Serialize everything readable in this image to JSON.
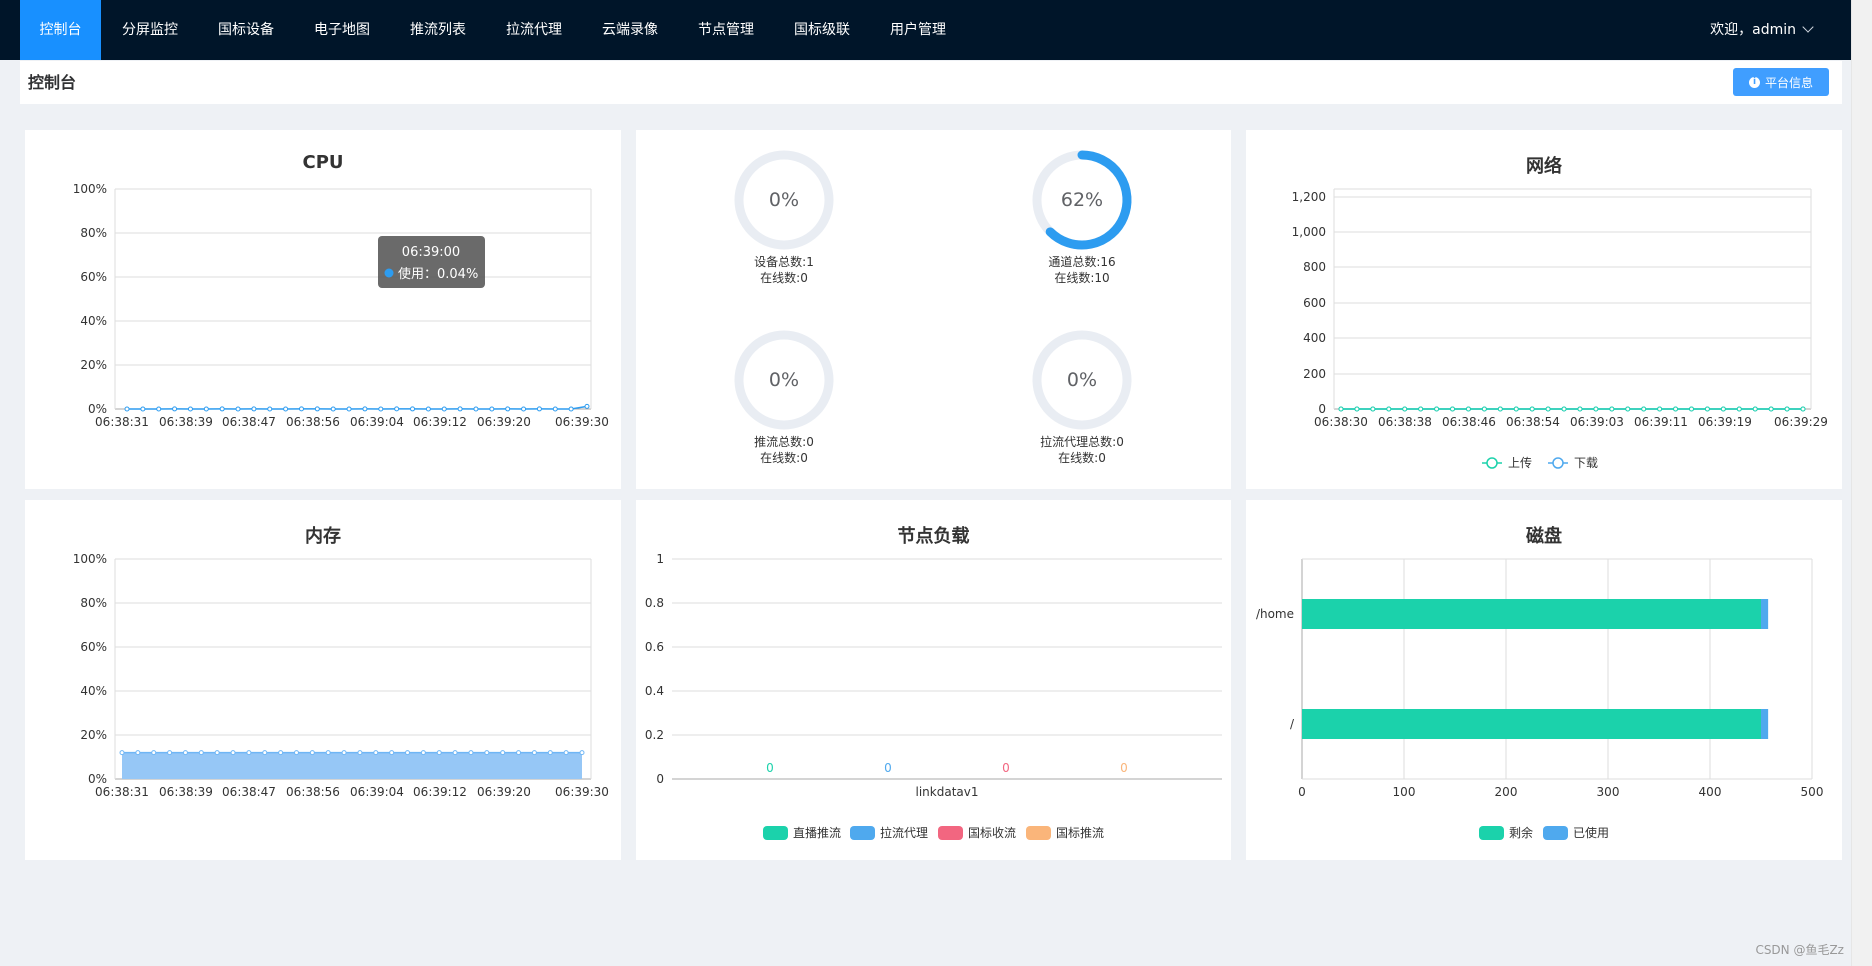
{
  "nav": {
    "items": [
      {
        "label": "控制台",
        "name": "nav-item-dashboard",
        "active": true
      },
      {
        "label": "分屏监控",
        "name": "nav-item-split-screen"
      },
      {
        "label": "国标设备",
        "name": "nav-item-gb-devices"
      },
      {
        "label": "电子地图",
        "name": "nav-item-map"
      },
      {
        "label": "推流列表",
        "name": "nav-item-push-list"
      },
      {
        "label": "拉流代理",
        "name": "nav-item-pull-proxy"
      },
      {
        "label": "云端录像",
        "name": "nav-item-cloud-record"
      },
      {
        "label": "节点管理",
        "name": "nav-item-node-manage"
      },
      {
        "label": "国标级联",
        "name": "nav-item-gb-cascade"
      },
      {
        "label": "用户管理",
        "name": "nav-item-user-manage"
      }
    ],
    "welcome": "欢迎，admin"
  },
  "header": {
    "title": "控制台",
    "platform_button": "平台信息"
  },
  "cpu": {
    "title": "CPU",
    "tooltip_time": "06:39:00",
    "tooltip_label": "使用：0.04%"
  },
  "gauges": [
    {
      "percent": "0%",
      "label1": "设备总数:1",
      "label2": "在线数:0",
      "fraction": 0
    },
    {
      "percent": "62%",
      "label1": "通道总数:16",
      "label2": "在线数:10",
      "fraction": 0.625
    },
    {
      "percent": "0%",
      "label1": "推流总数:0",
      "label2": "在线数:0",
      "fraction": 0
    },
    {
      "percent": "0%",
      "label1": "拉流代理总数:0",
      "label2": "在线数:0",
      "fraction": 0
    }
  ],
  "network": {
    "title": "网络",
    "legend": [
      "上传",
      "下载"
    ]
  },
  "memory": {
    "title": "内存"
  },
  "node_load": {
    "title": "节点负载",
    "legend": [
      "直播推流",
      "拉流代理",
      "国标收流",
      "国标推流"
    ]
  },
  "disk": {
    "title": "磁盘",
    "legend": [
      "剩余",
      "已使用"
    ]
  },
  "footer": "CSDN @鱼毛Zz",
  "colors": {
    "nav_bg": "#001529",
    "accent": "#1890ff",
    "teal": "#1bd2ab",
    "blue": "#4fa9ee",
    "red": "#f26680",
    "orange": "#fab57a"
  },
  "chart_data": [
    {
      "type": "line",
      "title": "CPU",
      "x": [
        "06:38:31",
        "06:38:39",
        "06:38:47",
        "06:38:56",
        "06:39:04",
        "06:39:12",
        "06:39:20",
        "06:39:30"
      ],
      "tick_labels_y": [
        "0%",
        "20%",
        "40%",
        "60%",
        "80%",
        "100%"
      ],
      "ylim": [
        0,
        100
      ],
      "series": [
        {
          "name": "使用",
          "values": [
            0,
            0.02,
            0.02,
            0.03,
            0.02,
            0.02,
            0.03,
            0.02,
            0.03,
            0.02,
            0.02,
            0.04,
            0.03,
            0.02,
            0.02,
            0.03,
            0.02,
            0.04,
            0.03,
            0.02,
            0.02,
            0.03,
            0.02,
            0.02,
            0.03,
            0.02,
            0.03,
            0.02,
            0.02,
            1.2
          ]
        }
      ]
    },
    {
      "type": "line",
      "title": "网络",
      "x": [
        "06:38:30",
        "06:38:38",
        "06:38:46",
        "06:38:54",
        "06:39:03",
        "06:39:11",
        "06:39:19",
        "06:39:29"
      ],
      "tick_labels_y": [
        "0",
        "200",
        "400",
        "600",
        "800",
        "1,000",
        "1,200"
      ],
      "ylim": [
        0,
        1250
      ],
      "series": [
        {
          "name": "上传",
          "values": [
            0,
            0,
            0,
            0,
            0,
            0,
            0,
            0,
            0,
            0,
            0,
            0,
            0,
            0,
            0,
            0,
            0,
            0,
            0,
            0,
            0,
            0,
            0,
            0,
            0,
            0,
            0,
            0,
            0,
            0
          ]
        },
        {
          "name": "下载",
          "values": [
            0,
            0,
            0,
            0,
            0,
            0,
            0,
            0,
            0,
            0,
            0,
            0,
            0,
            0,
            0,
            0,
            0,
            0,
            0,
            0,
            0,
            0,
            0,
            0,
            0,
            0,
            0,
            0,
            0,
            0
          ]
        }
      ]
    },
    {
      "type": "area",
      "title": "内存",
      "x": [
        "06:38:31",
        "06:38:39",
        "06:38:47",
        "06:38:56",
        "06:39:04",
        "06:39:12",
        "06:39:20",
        "06:39:30"
      ],
      "tick_labels_y": [
        "0%",
        "20%",
        "40%",
        "60%",
        "80%",
        "100%"
      ],
      "ylim": [
        0,
        100
      ],
      "series": [
        {
          "name": "使用",
          "values": [
            12,
            12,
            12,
            12,
            12,
            12,
            12,
            12,
            12,
            12,
            12,
            12,
            12,
            12,
            12,
            12,
            12,
            12,
            12,
            12,
            12,
            12,
            12,
            12,
            12,
            12,
            12,
            12,
            12,
            12
          ]
        }
      ]
    },
    {
      "type": "bar",
      "title": "节点负载",
      "categories": [
        "linkdatav1"
      ],
      "tick_labels_y": [
        "0",
        "0.2",
        "0.4",
        "0.6",
        "0.8",
        "1"
      ],
      "ylim": [
        0,
        1
      ],
      "series": [
        {
          "name": "直播推流",
          "values": [
            0
          ]
        },
        {
          "name": "拉流代理",
          "values": [
            0
          ]
        },
        {
          "name": "国标收流",
          "values": [
            0
          ]
        },
        {
          "name": "国标推流",
          "values": [
            0
          ]
        }
      ]
    },
    {
      "type": "bar",
      "title": "磁盘",
      "orientation": "horizontal",
      "stacked": true,
      "categories": [
        "/home",
        "/"
      ],
      "tick_labels_x": [
        "0",
        "100",
        "200",
        "300",
        "400",
        "500"
      ],
      "xlim": [
        0,
        500
      ],
      "series": [
        {
          "name": "剩余",
          "values": [
            450,
            450
          ]
        },
        {
          "name": "已使用",
          "values": [
            7,
            7
          ]
        }
      ]
    }
  ]
}
